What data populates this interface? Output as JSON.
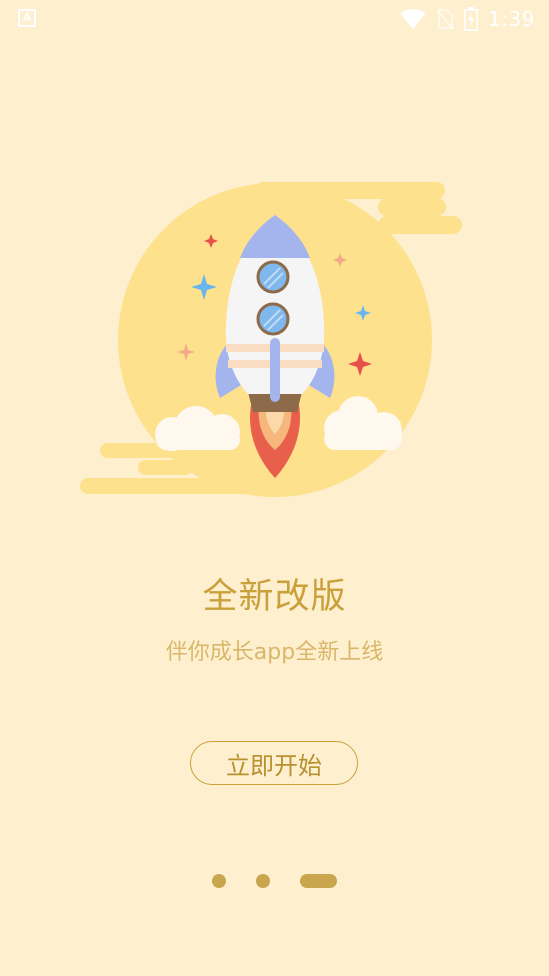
{
  "status_bar": {
    "left_icon": "A",
    "time": "1:39",
    "icons": [
      "wifi-icon",
      "no-sim-icon",
      "battery-charging-icon"
    ],
    "icon_color": "#FFFFFF"
  },
  "illustration": {
    "subject": "rocket-launch",
    "colors": {
      "background": "#FEF0CF",
      "circle": "#FDE18C",
      "rocket_body": "#F5F5F5",
      "rocket_accent": "#A3B5EC",
      "flame_outer": "#E8604C",
      "flame_inner": "#F6B77C",
      "cloud": "#FFF8EE",
      "star_red": "#E8504A",
      "star_blue": "#69B7EE",
      "star_peach": "#F4A98A"
    }
  },
  "content": {
    "title": "全新改版",
    "subtitle": "伴你成长app全新上线",
    "start_button_label": "立即开始"
  },
  "pager": {
    "total": 3,
    "current": 3,
    "color": "#C9A64E"
  }
}
